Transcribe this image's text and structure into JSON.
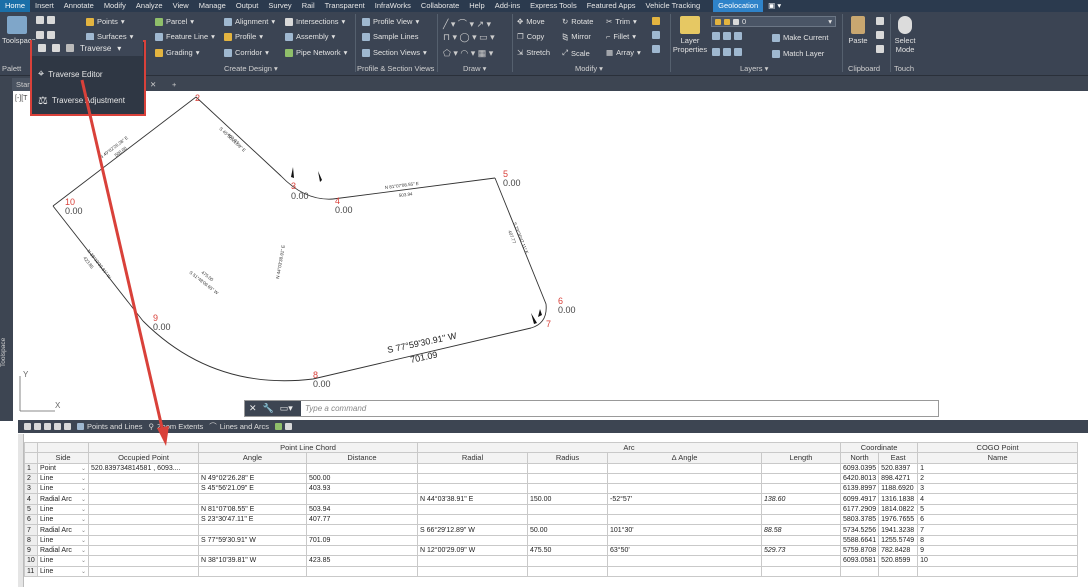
{
  "menu": [
    "Home",
    "Insert",
    "Annotate",
    "Modify",
    "Analyze",
    "View",
    "Manage",
    "Output",
    "Survey",
    "Rail",
    "Transparent",
    "InfraWorks",
    "Collaborate",
    "Help",
    "Add-ins",
    "Express Tools",
    "Featured Apps",
    "Vehicle Tracking",
    "Geolocation"
  ],
  "ribbon": {
    "toolspace": "Toolspace",
    "points": "Points",
    "surfaces": "Surfaces",
    "traverse": "Traverse",
    "parcel": "Parcel",
    "feature_line": "Feature Line",
    "grading": "Grading",
    "alignment": "Alignment",
    "profile": "Profile",
    "corridor": "Corridor",
    "intersections": "Intersections",
    "assembly": "Assembly",
    "pipe_network": "Pipe Network",
    "profile_view": "Profile View",
    "sample_lines": "Sample Lines",
    "section_views": "Section Views",
    "move": "Move",
    "copy": "Copy",
    "stretch": "Stretch",
    "rotate": "Rotate",
    "mirror": "Mirror",
    "scale": "Scale",
    "trim": "Trim",
    "fillet": "Fillet",
    "array": "Array",
    "layer_properties_1": "Layer",
    "layer_properties_2": "Properties",
    "layer_value": "0",
    "make_current": "Make Current",
    "match_layer": "Match Layer",
    "paste": "Paste",
    "select_mode_1": "Select",
    "select_mode_2": "Mode",
    "panels": {
      "palettes": "Palett",
      "create_design": "Create Design",
      "profile_section": "Profile & Section Views",
      "draw": "Draw",
      "modify": "Modify",
      "layers": "Layers",
      "clipboard": "Clipboard",
      "touch": "Touch"
    }
  },
  "tabs": {
    "start": "Star"
  },
  "dropdown": {
    "items": [
      "Traverse Editor",
      "Traverse Adjustment"
    ]
  },
  "drawing": {
    "view_label": "[-][T",
    "points": [
      {
        "num": "2",
        "elev": ""
      },
      {
        "num": "3",
        "elev": "0.00"
      },
      {
        "num": "4",
        "elev": "0.00"
      },
      {
        "num": "5",
        "elev": "0.00"
      },
      {
        "num": "6",
        "elev": "0.00"
      },
      {
        "num": "7",
        "elev": ""
      },
      {
        "num": "8",
        "elev": "0.00"
      },
      {
        "num": "9",
        "elev": "0.00"
      },
      {
        "num": "10",
        "elev": "0.00"
      }
    ],
    "bearing_main": "S 77°59'30.91\" W",
    "distance_main": "701.09",
    "small_labels": [
      "N 49°02'26.28\" E",
      "500.00",
      "S 45°56'21.09\" E",
      "403.93",
      "N 81°07'08.55\" E",
      "503.94",
      "S 23°30'47.11\" E",
      "407.77",
      "N 38°10'39.81\" W",
      "423.85",
      "S 51°48'09.65\" W",
      "475.00",
      "N 44°03'38.91\" E"
    ],
    "ucs_y": "Y",
    "ucs_x": "X"
  },
  "toolspace_label": "Toolspace",
  "command": {
    "placeholder": "Type a command"
  },
  "grid_toolbar": {
    "points_and_lines": "Points and Lines",
    "zoom_extents": "Zoom Extents",
    "lines_and_arcs": "Lines and Arcs"
  },
  "table": {
    "group_headers": {
      "plc": "Point Line Chord",
      "arc": "Arc",
      "coordinate": "Coordinate",
      "cogo": "COGO Point"
    },
    "columns": [
      "Side",
      "Occupied Point",
      "Angle",
      "Distance",
      "Radial",
      "Radius",
      "Δ Angle",
      "Length",
      "North",
      "East",
      "Name"
    ],
    "rows": [
      {
        "n": "1",
        "side": "Point",
        "occ": "520.839734814581 , 6093....",
        "angle": "",
        "dist": "",
        "radial": "",
        "radius": "",
        "delta": "",
        "length": "",
        "north": "6093.0395",
        "east": "520.8397",
        "name": "1"
      },
      {
        "n": "2",
        "side": "Line",
        "occ": "",
        "angle": "N 49°02'26.28\" E",
        "dist": "500.00",
        "radial": "",
        "radius": "",
        "delta": "",
        "length": "",
        "north": "6420.8013",
        "east": "898.4271",
        "name": "2"
      },
      {
        "n": "3",
        "side": "Line",
        "occ": "",
        "angle": "S 45°56'21.09\" E",
        "dist": "403.93",
        "radial": "",
        "radius": "",
        "delta": "",
        "length": "",
        "north": "6139.8997",
        "east": "1188.6920",
        "name": "3"
      },
      {
        "n": "4",
        "side": "Radial Arc",
        "occ": "",
        "angle": "",
        "dist": "",
        "radial": "N 44°03'38.91\" E",
        "radius": "150.00",
        "delta": "-52°57'",
        "length": "138.60",
        "north": "6099.4917",
        "east": "1316.1838",
        "name": "4"
      },
      {
        "n": "5",
        "side": "Line",
        "occ": "",
        "angle": "N 81°07'08.55\" E",
        "dist": "503.94",
        "radial": "",
        "radius": "",
        "delta": "",
        "length": "",
        "north": "6177.2909",
        "east": "1814.0822",
        "name": "5"
      },
      {
        "n": "6",
        "side": "Line",
        "occ": "",
        "angle": "S 23°30'47.11\" E",
        "dist": "407.77",
        "radial": "",
        "radius": "",
        "delta": "",
        "length": "",
        "north": "5803.3785",
        "east": "1976.7655",
        "name": "6"
      },
      {
        "n": "7",
        "side": "Radial Arc",
        "occ": "",
        "angle": "",
        "dist": "",
        "radial": "S 66°29'12.89\" W",
        "radius": "50.00",
        "delta": "101°30'",
        "length": "88.58",
        "north": "5734.5256",
        "east": "1941.3238",
        "name": "7"
      },
      {
        "n": "8",
        "side": "Line",
        "occ": "",
        "angle": "S 77°59'30.91\" W",
        "dist": "701.09",
        "radial": "",
        "radius": "",
        "delta": "",
        "length": "",
        "north": "5588.6641",
        "east": "1255.5749",
        "name": "8"
      },
      {
        "n": "9",
        "side": "Radial Arc",
        "occ": "",
        "angle": "",
        "dist": "",
        "radial": "N 12°00'29.09\" W",
        "radius": "475.50",
        "delta": "63°50'",
        "length": "529.73",
        "north": "5759.8708",
        "east": "782.8428",
        "name": "9"
      },
      {
        "n": "10",
        "side": "Line",
        "occ": "",
        "angle": "N 38°10'39.81\" W",
        "dist": "423.85",
        "radial": "",
        "radius": "",
        "delta": "",
        "length": "",
        "north": "6093.0581",
        "east": "520.8599",
        "name": "10"
      },
      {
        "n": "11",
        "side": "Line",
        "occ": "",
        "angle": "",
        "dist": "",
        "radial": "",
        "radius": "",
        "delta": "",
        "length": "",
        "north": "",
        "east": "",
        "name": ""
      }
    ]
  },
  "colors": {
    "ribbon": "#3b4453",
    "accent": "#d9413a",
    "point_label": "#d9413a"
  }
}
